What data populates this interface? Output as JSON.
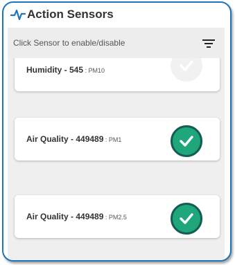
{
  "header": {
    "title": "Action Sensors",
    "icon": "pulse-icon",
    "accent_color": "#1f73b7"
  },
  "toolbar": {
    "hint": "Click Sensor to enable/disable",
    "filter_icon": "filter-icon"
  },
  "sensors": [
    {
      "name": "Humidity - 545",
      "separator": " : ",
      "unit": "PM10",
      "enabled": false
    },
    {
      "name": "Air Quality - 449489",
      "separator": " : ",
      "unit": "PM1",
      "enabled": true
    },
    {
      "name": "Air Quality - 449489",
      "separator": " : ",
      "unit": "PM2.5",
      "enabled": true
    }
  ],
  "colors": {
    "enabled_fill": "#1fa67a",
    "enabled_border": "#145c54",
    "disabled_fill": "#f1f1f1"
  }
}
